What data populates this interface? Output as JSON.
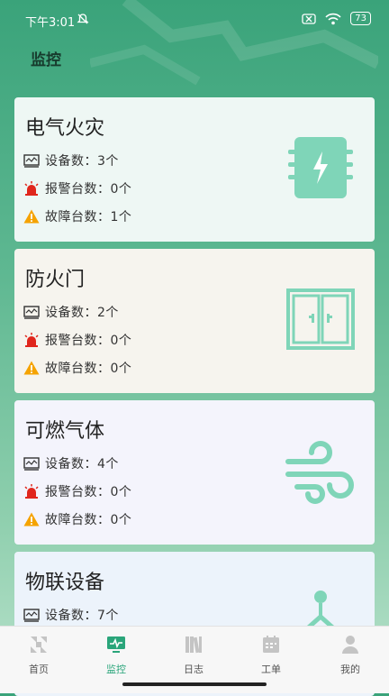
{
  "status_bar": {
    "time": "下午3:01",
    "battery": "73"
  },
  "page": {
    "title": "监控"
  },
  "cards": [
    {
      "title": "电气火灾",
      "devices": "设备数：3个",
      "alarms": "报警台数：0个",
      "faults": "故障台数：1个",
      "icon": "chip-lightning-icon",
      "bg": "#eef7f4"
    },
    {
      "title": "防火门",
      "devices": "设备数：2个",
      "alarms": "报警台数：0个",
      "faults": "故障台数：0个",
      "icon": "fire-door-icon",
      "bg": "#f6f4ee"
    },
    {
      "title": "可燃气体",
      "devices": "设备数：4个",
      "alarms": "报警台数：0个",
      "faults": "故障台数：0个",
      "icon": "gas-wind-icon",
      "bg": "#f4f4fc"
    },
    {
      "title": "物联设备",
      "devices": "设备数：7个",
      "icon": "iot-device-icon",
      "bg": "#ecf3fb"
    }
  ],
  "tabbar": {
    "items": [
      {
        "label": "首页",
        "icon": "home-grid-icon"
      },
      {
        "label": "监控",
        "icon": "monitor-icon"
      },
      {
        "label": "日志",
        "icon": "books-icon"
      },
      {
        "label": "工单",
        "icon": "calendar-icon"
      },
      {
        "label": "我的",
        "icon": "user-icon"
      }
    ],
    "active": "监控"
  },
  "colors": {
    "accent": "#2aa57a",
    "icon_green": "#7fd5b8",
    "header_green": "#3aa37a"
  }
}
